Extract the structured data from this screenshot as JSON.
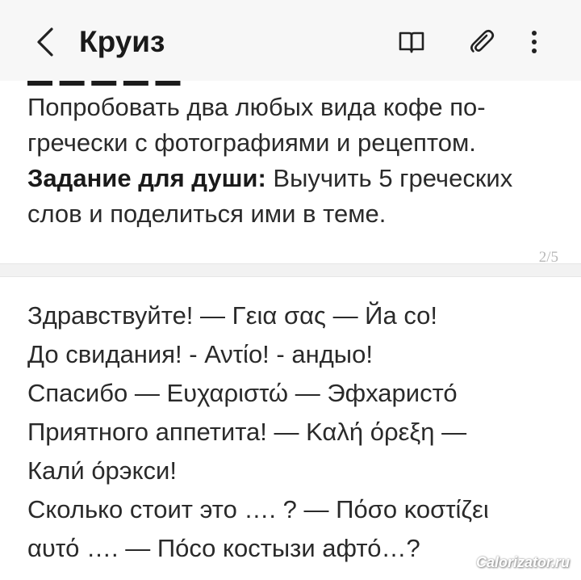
{
  "header": {
    "title": "Круиз",
    "back_icon": "chevron-left-icon",
    "book_icon": "open-book-icon",
    "clip_icon": "paperclip-icon",
    "more_icon": "vertical-ellipsis-icon"
  },
  "card1": {
    "line1": "Попробовать два любых вида кофе по-",
    "line2": "гречески с фотографиями и рецептом.",
    "task_label": "Задание для души:",
    "task_rest": " Выучить 5 греческих",
    "line4": "слов и поделиться ими в теме.",
    "counter": "2/5"
  },
  "card2": {
    "lines": [
      "Здравствуйте! — Γεια σας — Йа со!",
      "До свидания! - Αντίο! - андыо!",
      "Спасибо — Ευχαριστώ — Эфхаристо́",
      "Приятного аппетита! — Καλή όρεξη —",
      "Кали́ о́рэкси!",
      "Сколько стоит это …. ? — Πόσο κοστίζει",
      "αυτό …. — По́со костызи афто́…?"
    ]
  },
  "watermark": "Calorizator.ru"
}
